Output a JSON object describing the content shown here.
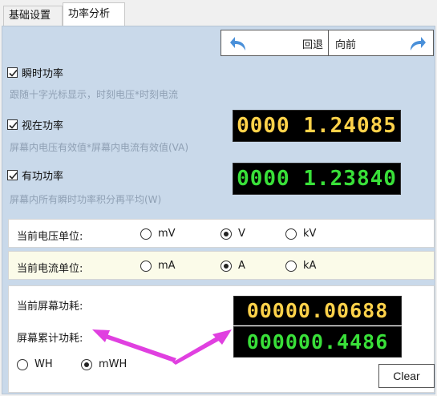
{
  "tabs": [
    {
      "label": "基础设置",
      "active": false
    },
    {
      "label": "功率分析",
      "active": true
    }
  ],
  "nav": {
    "back_label": "回退",
    "forward_label": "向前",
    "back_icon": "undo-arrow-icon",
    "forward_icon": "redo-arrow-icon",
    "icon_color": "#4a90d9"
  },
  "instant_power": {
    "label": "瞬时功率",
    "checked": true,
    "description": "跟随十字光标显示，时刻电压*时刻电流"
  },
  "apparent_power": {
    "label": "视在功率",
    "checked": true,
    "description": "屏幕内电压有效值*屏幕内电流有效值(VA)",
    "display": "0000 1.24085",
    "color": "#ffd24a"
  },
  "active_power": {
    "label": "有功功率",
    "checked": true,
    "description": "屏幕内所有瞬时功率积分再平均(W)",
    "display": "0000 1.23840",
    "color": "#39e039"
  },
  "voltage_unit": {
    "label": "当前电压单位:",
    "options": [
      "mV",
      "V",
      "kV"
    ],
    "selected": "V"
  },
  "current_unit": {
    "label": "当前电流单位:",
    "options": [
      "mA",
      "A",
      "kA"
    ],
    "selected": "A"
  },
  "power_consumption": {
    "screen_label": "当前屏幕功耗:",
    "screen_value": "00000.00688",
    "cumulative_label": "屏幕累计功耗:",
    "cumulative_value": "000000.4486",
    "unit_options": [
      "WH",
      "mWH"
    ],
    "unit_selected": "mWH",
    "clear_label": "Clear"
  },
  "colors": {
    "panel": "#c9d9ea",
    "annotation_arrow": "#e040e0",
    "lcd_yellow": "#ffd24a",
    "lcd_green": "#39e039"
  }
}
